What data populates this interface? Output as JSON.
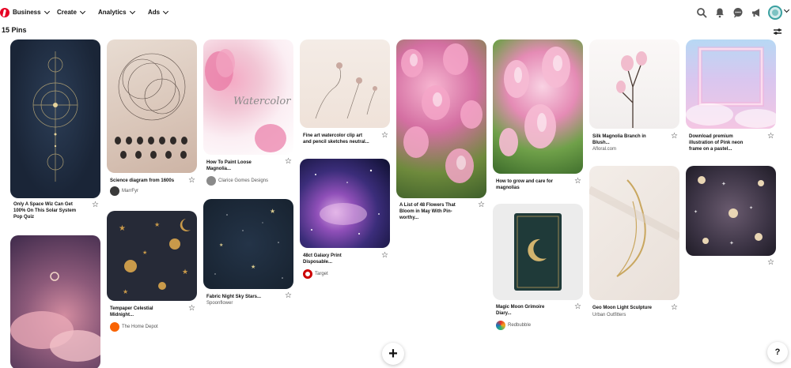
{
  "nav": {
    "items": [
      {
        "label": "Business"
      },
      {
        "label": "Create"
      },
      {
        "label": "Analytics"
      },
      {
        "label": "Ads"
      }
    ]
  },
  "board": {
    "pin_count": "15 Pins"
  },
  "pins": [
    {
      "title_lines": [
        "Only A Space Wiz Can Get",
        "100% On This Solar System",
        "Pop Quiz"
      ]
    },
    {
      "title_lines": [
        "Science diagram from 1600s"
      ],
      "source": "MarrFyr"
    },
    {
      "title_lines": [
        "How To Paint Loose",
        "Magnolia..."
      ],
      "source": "Clarice Gomes Designs"
    },
    {
      "title_lines": [
        "Fine art watercolor clip art",
        "and pencil sketches neutral..."
      ]
    },
    {
      "title_lines": [
        "A List of 48 Flowers That",
        "Bloom in May With Pin-",
        "worthy..."
      ]
    },
    {
      "title_lines": [
        "How to grow and care for",
        "magnolias"
      ]
    },
    {
      "title_lines": [
        "Silk Magnolia Branch in",
        "Blush..."
      ],
      "source": "Afloral.com"
    },
    {
      "title_lines": [
        "Download premium",
        "illustration of Pink neon",
        "frame on a pastel..."
      ]
    },
    {
      "title_lines": []
    },
    {
      "title_lines": [
        "Tempaper Celestial",
        "Midnight..."
      ],
      "source": "The Home Depot"
    },
    {
      "title_lines": [
        "Fabric Night Sky Stars..."
      ],
      "source": "Spoonflower"
    },
    {
      "title_lines": [
        "48ct Galaxy Print",
        "Disposable..."
      ],
      "source": "Target"
    },
    {
      "title_lines": [
        "Magic Moon Grimoire",
        "Diary..."
      ],
      "source": "Redbubble"
    },
    {
      "title_lines": [
        "Geo Moon Light Sculpture"
      ],
      "source": "Urban Outfitters"
    },
    {
      "title_lines": []
    }
  ],
  "icons": {
    "star": "☆",
    "fab": "+",
    "help": "?"
  },
  "colors": {
    "brand": "#e60023"
  }
}
